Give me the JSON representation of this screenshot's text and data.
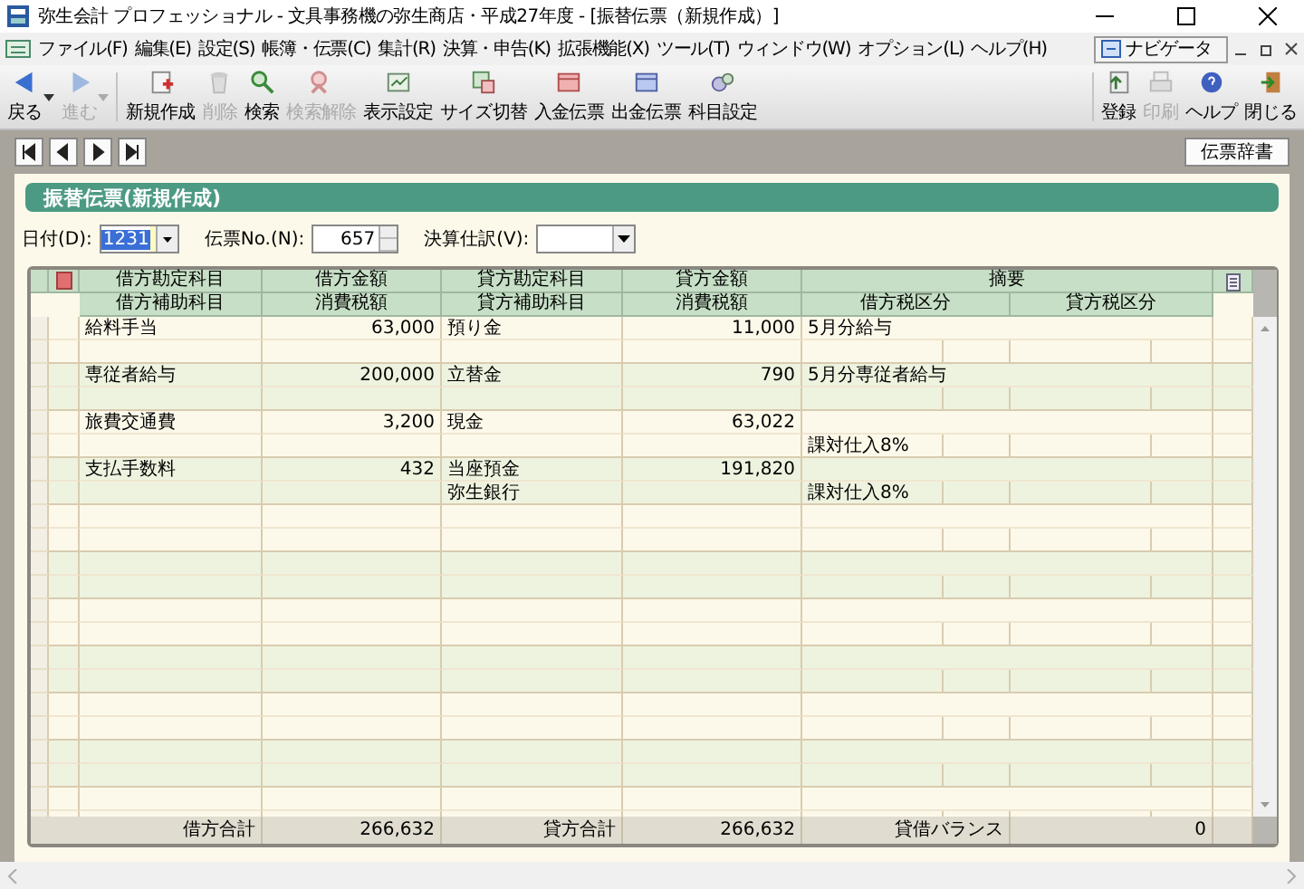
{
  "window": {
    "title": "弥生会計 プロフェッショナル - 文具事務機の弥生商店・平成27年度 - [振替伝票（新規作成）]"
  },
  "menu": [
    "ファイル(F)",
    "編集(E)",
    "設定(S)",
    "帳簿・伝票(C)",
    "集計(R)",
    "決算・申告(K)",
    "拡張機能(X)",
    "ツール(T)",
    "ウィンドウ(W)",
    "オプション(L)",
    "ヘルプ(H)"
  ],
  "navigator": {
    "label": "ナビゲータ"
  },
  "toolbar": [
    {
      "label": "戻る",
      "disabled": false,
      "dropdown": true
    },
    {
      "label": "進む",
      "disabled": true,
      "dropdown": true
    },
    {
      "label": "新規作成",
      "disabled": false,
      "dropdown": false
    },
    {
      "label": "削除",
      "disabled": true,
      "dropdown": false
    },
    {
      "label": "検索",
      "disabled": false,
      "dropdown": false
    },
    {
      "label": "検索解除",
      "disabled": true,
      "dropdown": false
    },
    {
      "label": "表示設定",
      "disabled": false,
      "dropdown": false
    },
    {
      "label": "サイズ切替",
      "disabled": false,
      "dropdown": false
    },
    {
      "label": "入金伝票",
      "disabled": false,
      "dropdown": false
    },
    {
      "label": "出金伝票",
      "disabled": false,
      "dropdown": false
    },
    {
      "label": "科目設定",
      "disabled": false,
      "dropdown": false
    }
  ],
  "toolbar_right": [
    {
      "label": "登録",
      "disabled": false
    },
    {
      "label": "印刷",
      "disabled": true
    },
    {
      "label": "ヘルプ",
      "disabled": false
    },
    {
      "label": "閉じる",
      "disabled": false
    }
  ],
  "dictionary_button": "伝票辞書",
  "panel_title": "振替伝票(新規作成)",
  "form": {
    "date_label": "日付(D):",
    "date_value": "1231",
    "number_label": "伝票No.(N):",
    "number_value": "657",
    "closing_label": "決算仕訳(V):"
  },
  "table": {
    "header_top": [
      "借方勘定科目",
      "借方金額",
      "貸方勘定科目",
      "貸方金額",
      "摘要"
    ],
    "header_bottom": [
      "借方補助科目",
      "消費税額",
      "貸方補助科目",
      "消費税額",
      "借方税区分",
      "貸方税区分"
    ],
    "rows": [
      {
        "debit_account": "給料手当",
        "debit_amount": "63,000",
        "credit_account": "預り金",
        "credit_amount": "11,000",
        "memo": "5月分給与",
        "debit_sub": "",
        "debit_tax": "",
        "credit_sub": "",
        "credit_tax": "",
        "debit_tax_class": "",
        "credit_tax_class": ""
      },
      {
        "debit_account": "専従者給与",
        "debit_amount": "200,000",
        "credit_account": "立替金",
        "credit_amount": "790",
        "memo": "5月分専従者給与",
        "debit_sub": "",
        "debit_tax": "",
        "credit_sub": "",
        "credit_tax": "",
        "debit_tax_class": "",
        "credit_tax_class": ""
      },
      {
        "debit_account": "旅費交通費",
        "debit_amount": "3,200",
        "credit_account": "現金",
        "credit_amount": "63,022",
        "memo": "",
        "debit_sub": "",
        "debit_tax": "",
        "credit_sub": "",
        "credit_tax": "",
        "debit_tax_class": "課対仕入8%",
        "credit_tax_class": ""
      },
      {
        "debit_account": "支払手数料",
        "debit_amount": "432",
        "credit_account": "当座預金",
        "credit_amount": "191,820",
        "memo": "",
        "debit_sub": "",
        "debit_tax": "",
        "credit_sub": "弥生銀行",
        "credit_tax": "",
        "debit_tax_class": "課対仕入8%",
        "credit_tax_class": ""
      }
    ],
    "totals": [
      {
        "label": "借方合計",
        "value": "266,632"
      },
      {
        "label": "貸方合計",
        "value": "266,632"
      },
      {
        "label": "貸借バランス",
        "value": "0"
      }
    ]
  }
}
